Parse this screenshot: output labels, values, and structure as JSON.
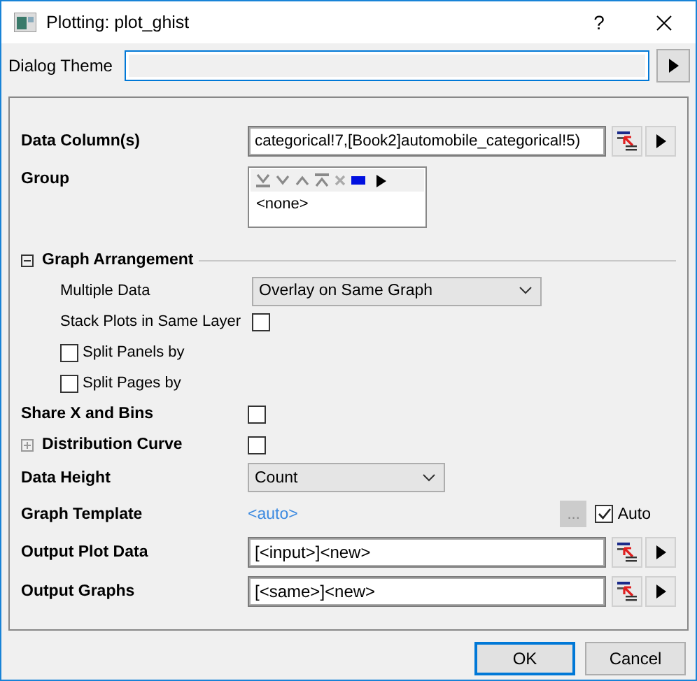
{
  "window": {
    "title": "Plotting: plot_ghist",
    "help": "?"
  },
  "dialog_theme": {
    "label": "Dialog Theme"
  },
  "rows": [
    {
      "kind": "field",
      "label": "Data Column(s)",
      "value": "categorical!7,[Book2]automobile_categorical!5)"
    },
    {
      "kind": "group",
      "label": "Group",
      "value": "<none>"
    },
    {
      "kind": "section",
      "label": "Graph Arrangement",
      "expanded": true,
      "children": [
        {
          "kind": "dropdown",
          "label": "Multiple Data",
          "value": "Overlay on Same Graph"
        },
        {
          "kind": "checkbox",
          "label": "Stack Plots in Same Layer",
          "checked": false
        },
        {
          "kind": "check_label",
          "label": "Split Panels by",
          "checked": false
        },
        {
          "kind": "check_label",
          "label": "Split Pages by",
          "checked": false
        }
      ]
    },
    {
      "kind": "checkbox",
      "label": "Share X and Bins",
      "checked": false
    },
    {
      "kind": "collapsed",
      "label": "Distribution Curve",
      "expanded": false,
      "checked": false
    },
    {
      "kind": "dropdown",
      "label": "Data Height",
      "value": "Count"
    },
    {
      "kind": "template",
      "label": "Graph Template",
      "value": "<auto>",
      "browse": "...",
      "auto_label": "Auto",
      "auto_checked": true
    },
    {
      "kind": "field",
      "label": "Output Plot Data",
      "value": "[<input>]<new>"
    },
    {
      "kind": "field",
      "label": "Output Graphs",
      "value": "[<same>]<new>"
    }
  ],
  "buttons": [
    {
      "label": "OK",
      "default": true
    },
    {
      "label": "Cancel",
      "default": false
    }
  ]
}
